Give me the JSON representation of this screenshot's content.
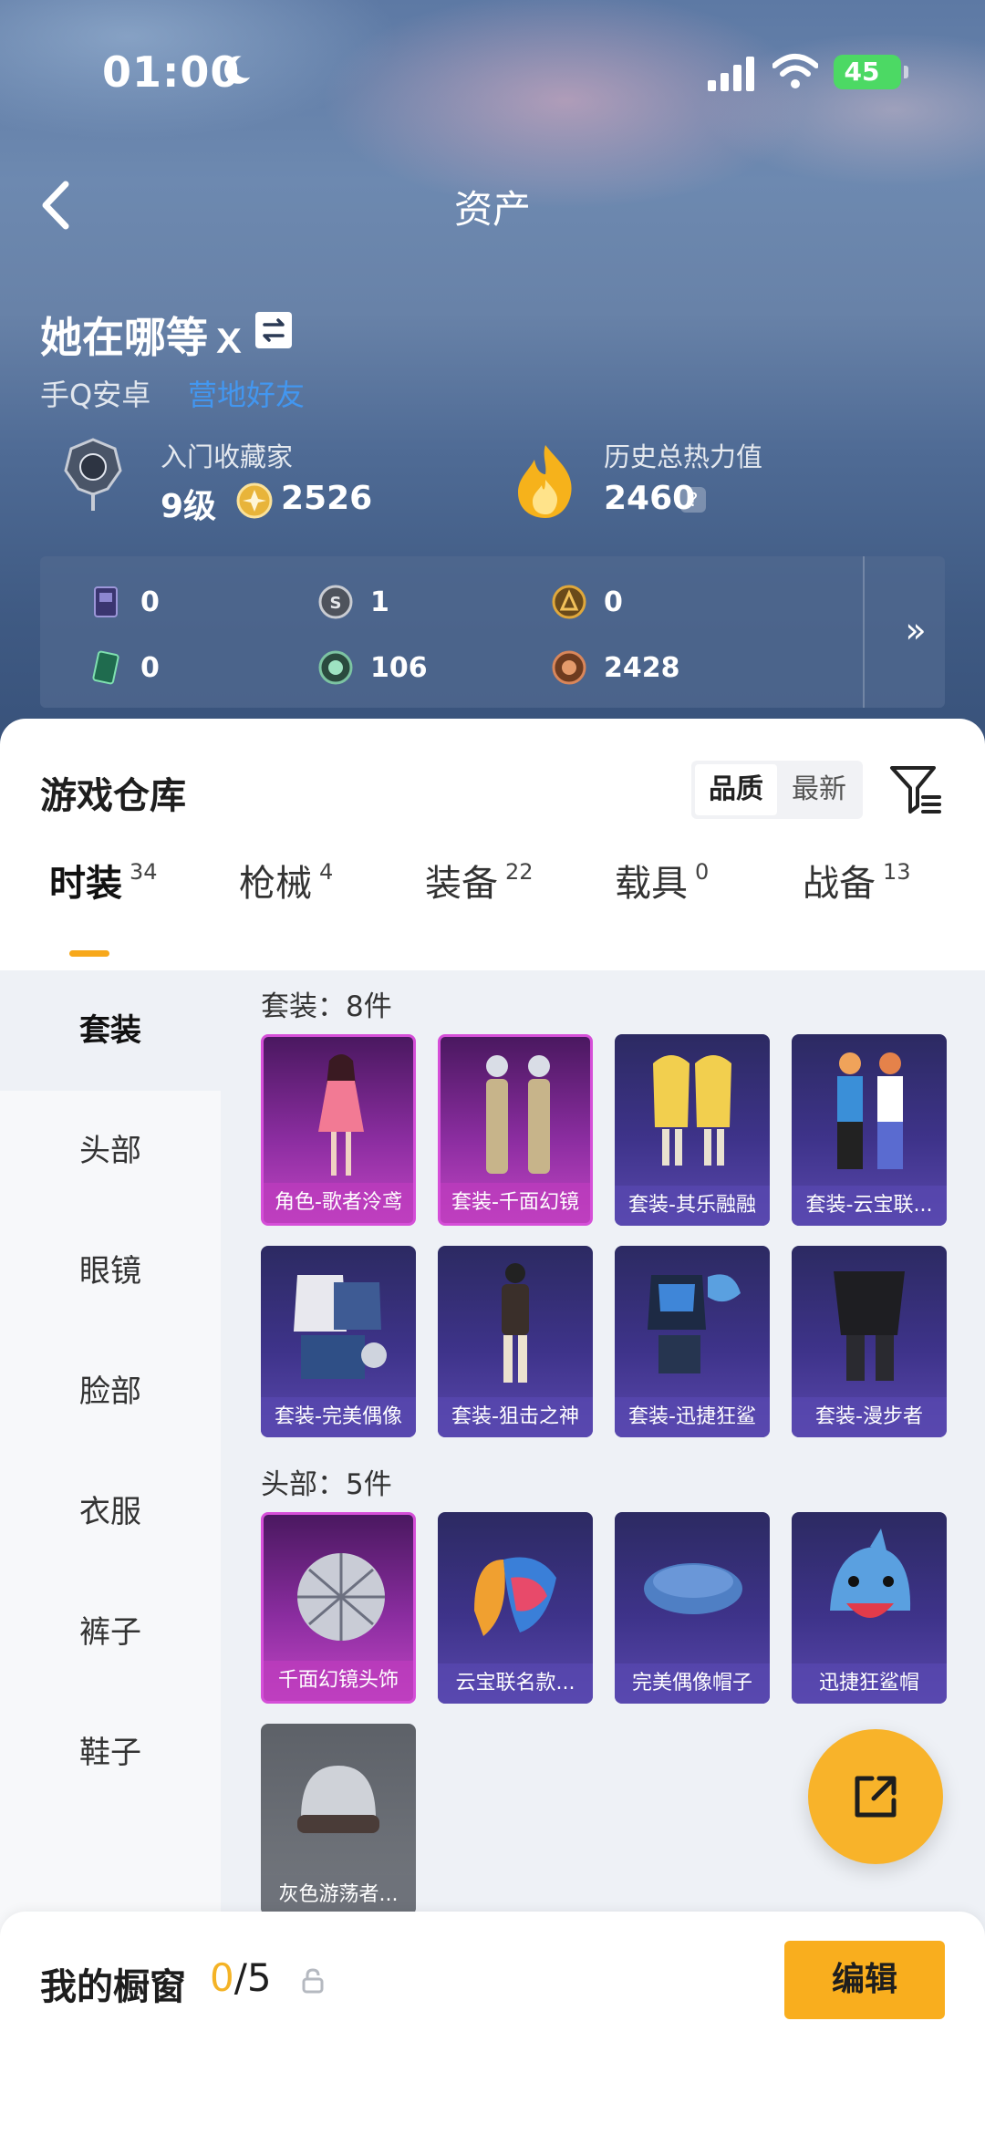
{
  "status_bar": {
    "time": "01:00",
    "battery": "45"
  },
  "nav": {
    "title": "资产"
  },
  "profile": {
    "name": "她在哪等ｘ",
    "platform": "手Q安卓",
    "platform_link": "营地好友",
    "collector_title": "入门收藏家",
    "collector_level": "9级",
    "collector_points": "2526",
    "heat_title": "历史总热力值",
    "heat_value": "2460",
    "help": "?"
  },
  "currencies": [
    {
      "icon": "card-icon",
      "value": "0"
    },
    {
      "icon": "silver-coin-icon",
      "value": "1"
    },
    {
      "icon": "gold-coin-icon",
      "value": "0"
    },
    {
      "icon": "ticket-icon",
      "value": "0"
    },
    {
      "icon": "green-gem-icon",
      "value": "106"
    },
    {
      "icon": "bronze-coin-icon",
      "value": "2428"
    }
  ],
  "warehouse": {
    "title": "游戏仓库",
    "sort_quality": "品质",
    "sort_newest": "最新",
    "more": "»"
  },
  "tabs": [
    {
      "label": "时装",
      "count": "34",
      "active": true
    },
    {
      "label": "枪械",
      "count": "4"
    },
    {
      "label": "装备",
      "count": "22"
    },
    {
      "label": "载具",
      "count": "0"
    },
    {
      "label": "战备",
      "count": "13"
    }
  ],
  "side_nav": [
    "套装",
    "头部",
    "眼镜",
    "脸部",
    "衣服",
    "裤子",
    "鞋子"
  ],
  "sections": [
    {
      "label": "套装：8件",
      "items": [
        {
          "label": "角色-歌者泠鸢",
          "rarity": "pink",
          "art": "female-character-icon"
        },
        {
          "label": "套装-千面幻镜",
          "rarity": "pink",
          "art": "mirror-suit-icon"
        },
        {
          "label": "套装-其乐融融",
          "rarity": "purple",
          "art": "yellow-hood-suit-icon"
        },
        {
          "label": "套装-云宝联...",
          "rarity": "purple",
          "art": "colorful-suit-icon"
        },
        {
          "label": "套装-完美偶像",
          "rarity": "purple",
          "art": "idol-suit-icon"
        },
        {
          "label": "套装-狙击之神",
          "rarity": "purple",
          "art": "sniper-suit-icon"
        },
        {
          "label": "套装-迅捷狂鲨",
          "rarity": "purple",
          "art": "shark-suit-icon"
        },
        {
          "label": "套装-漫步者",
          "rarity": "purple",
          "art": "walker-suit-icon"
        }
      ]
    },
    {
      "label": "头部：5件",
      "items": [
        {
          "label": "千面幻镜头饰",
          "rarity": "pink",
          "art": "disco-ball-helmet-icon"
        },
        {
          "label": "云宝联名款...",
          "rarity": "purple",
          "art": "rainbow-hair-icon"
        },
        {
          "label": "完美偶像帽子",
          "rarity": "purple",
          "art": "beret-icon"
        },
        {
          "label": "迅捷狂鲨帽",
          "rarity": "purple",
          "art": "shark-hat-icon"
        },
        {
          "label": "灰色游荡者...",
          "rarity": "grey",
          "art": "beanie-icon"
        }
      ]
    }
  ],
  "showcase": {
    "title": "我的橱窗",
    "current": "0",
    "total": "/5",
    "edit": "编辑"
  },
  "colors": {
    "accent": "#f9ae1e",
    "rare_purple": "#5a48ad",
    "rare_pink": "#c145c3",
    "link": "#3f9dff"
  }
}
